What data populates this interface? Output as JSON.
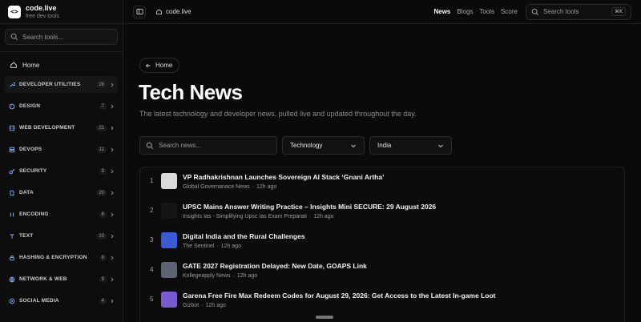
{
  "brand": {
    "name": "code.live",
    "tagline": "free dev tools",
    "logo_glyph": "<>"
  },
  "sidebar": {
    "search_placeholder": "Search tools...",
    "home_label": "Home",
    "categories": [
      {
        "label": "DEVELOPER UTILITIES",
        "count": "26",
        "icon": "wrench-icon"
      },
      {
        "label": "DESIGN",
        "count": "7",
        "icon": "palette-icon"
      },
      {
        "label": "WEB DEVELOPMENT",
        "count": "21",
        "icon": "code-icon"
      },
      {
        "label": "DEVOPS",
        "count": "11",
        "icon": "server-icon"
      },
      {
        "label": "SECURITY",
        "count": "9",
        "icon": "key-icon"
      },
      {
        "label": "DATA",
        "count": "20",
        "icon": "file-icon"
      },
      {
        "label": "ENCODING",
        "count": "6",
        "icon": "binary-icon"
      },
      {
        "label": "TEXT",
        "count": "10",
        "icon": "text-icon"
      },
      {
        "label": "HASHING & ENCRYPTION",
        "count": "8",
        "icon": "lock-icon"
      },
      {
        "label": "NETWORK & WEB",
        "count": "9",
        "icon": "globe-icon"
      },
      {
        "label": "SOCIAL MEDIA",
        "count": "4",
        "icon": "share-icon"
      }
    ]
  },
  "header": {
    "breadcrumb": "code.live",
    "nav": [
      "News",
      "Blogs",
      "Tools",
      "Score"
    ],
    "active_nav": "News",
    "search_placeholder": "Search tools",
    "shortcut": "⌘K"
  },
  "page": {
    "back_label": "Home",
    "title": "Tech News",
    "subtitle": "The latest technology and developer news, pulled live and updated throughout the day.",
    "search_placeholder": "Search news...",
    "topic": "Technology",
    "region": "India"
  },
  "news": [
    {
      "num": "1",
      "title": "VP Radhakrishnan Launches Sovereign AI Stack ‘Gnani Artha’",
      "source": "Global Governanace News",
      "time": "12h ago",
      "thumb": "#d9d9d9"
    },
    {
      "num": "2",
      "title": "UPSC Mains Answer Writing Practice – Insights Mini SECURE: 29 August 2026",
      "source": "Insights Ias - Simplifying Upsc Ias Exam Preparati",
      "time": "12h ago",
      "thumb": "#151515"
    },
    {
      "num": "3",
      "title": "Digital India and the Rural Challenges",
      "source": "The Sentinel",
      "time": "12h ago",
      "thumb": "#3b5bd6"
    },
    {
      "num": "4",
      "title": "GATE 2027 Registration Delayed: New Date, GOAPS Link",
      "source": "Kollegeapply News",
      "time": "12h ago",
      "thumb": "#5b6470"
    },
    {
      "num": "5",
      "title": "Garena Free Fire Max Redeem Codes for August 29, 2026: Get Access to the Latest In-game Loot",
      "source": "Gizbot",
      "time": "12h ago",
      "thumb": "#7a5ad0"
    }
  ]
}
